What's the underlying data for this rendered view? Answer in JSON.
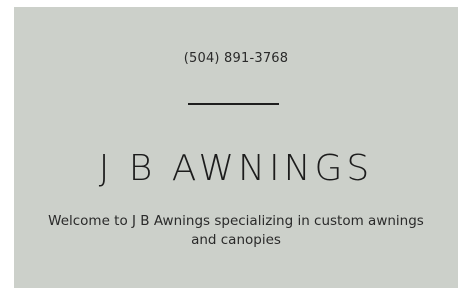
{
  "hero": {
    "phone": "(504) 891-3768",
    "title": "J B AWNINGS",
    "welcome": "Welcome to J B Awnings specializing in custom awnings and canopies"
  },
  "colors": {
    "hero_background": "#ccd0ca",
    "text": "#1e1e1e"
  }
}
